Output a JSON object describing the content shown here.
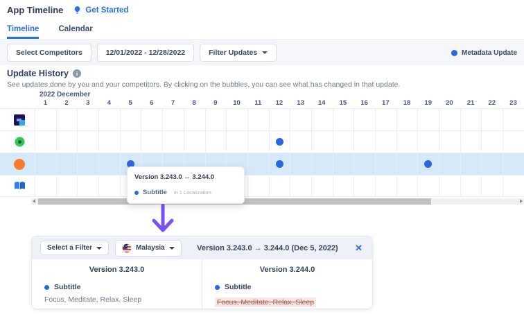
{
  "colors": {
    "accent": "#2d6ee8",
    "dot": "#2b67e0",
    "highlight_row": "#d6e9fb",
    "arrow": "#7a52f5",
    "strike_bg": "#fbe7e7",
    "strike_text": "#a8594f"
  },
  "header": {
    "title": "App Timeline",
    "get_started": "Get Started"
  },
  "tabs": [
    {
      "label": "Timeline",
      "active": true
    },
    {
      "label": "Calendar",
      "active": false
    }
  ],
  "toolbar": {
    "select_competitors": "Select Competitors",
    "date_range": "12/01/2022 - 12/28/2022",
    "filter_updates": "Filter Updates",
    "legend_label": "Metadata Update"
  },
  "section": {
    "title": "Update History",
    "description": "See updates done by you and your competitors. By clicking on the bubbles, you can see what has changed in that update."
  },
  "timeline": {
    "month_label": "2022 December",
    "days": [
      1,
      2,
      3,
      4,
      5,
      6,
      7,
      8,
      9,
      10,
      11,
      12,
      13,
      14,
      15,
      16,
      17,
      18,
      19,
      20,
      21,
      22,
      23
    ],
    "rows": [
      {
        "icon": "sleep-app",
        "highlighted": false
      },
      {
        "icon": "green-app",
        "highlighted": false
      },
      {
        "icon": "headspace-app",
        "highlighted": true
      },
      {
        "icon": "book-app",
        "highlighted": false
      }
    ],
    "dots": [
      {
        "row": 1,
        "day": 12
      },
      {
        "row": 2,
        "day": 5
      },
      {
        "row": 2,
        "day": 12
      },
      {
        "row": 2,
        "day": 19
      }
    ],
    "tooltip": {
      "title": "Version 3.243.0 ↔ 3.244.0",
      "field": "Subtitle",
      "meta": "in 1 Localization"
    }
  },
  "detail_panel": {
    "filter_label": "Select a Filter",
    "country": "Malaysia",
    "title": "Version 3.243.0 → 3.244.0 (Dec 5, 2022)",
    "close_label": "✕",
    "columns": [
      {
        "version": "Version 3.243.0",
        "field": "Subtitle",
        "value": "Focus, Meditate, Relax, Sleep",
        "removed": false
      },
      {
        "version": "Version 3.244.0",
        "field": "Subtitle",
        "value": "Focus, Meditate, Relax, Sleep",
        "removed": true
      }
    ]
  }
}
